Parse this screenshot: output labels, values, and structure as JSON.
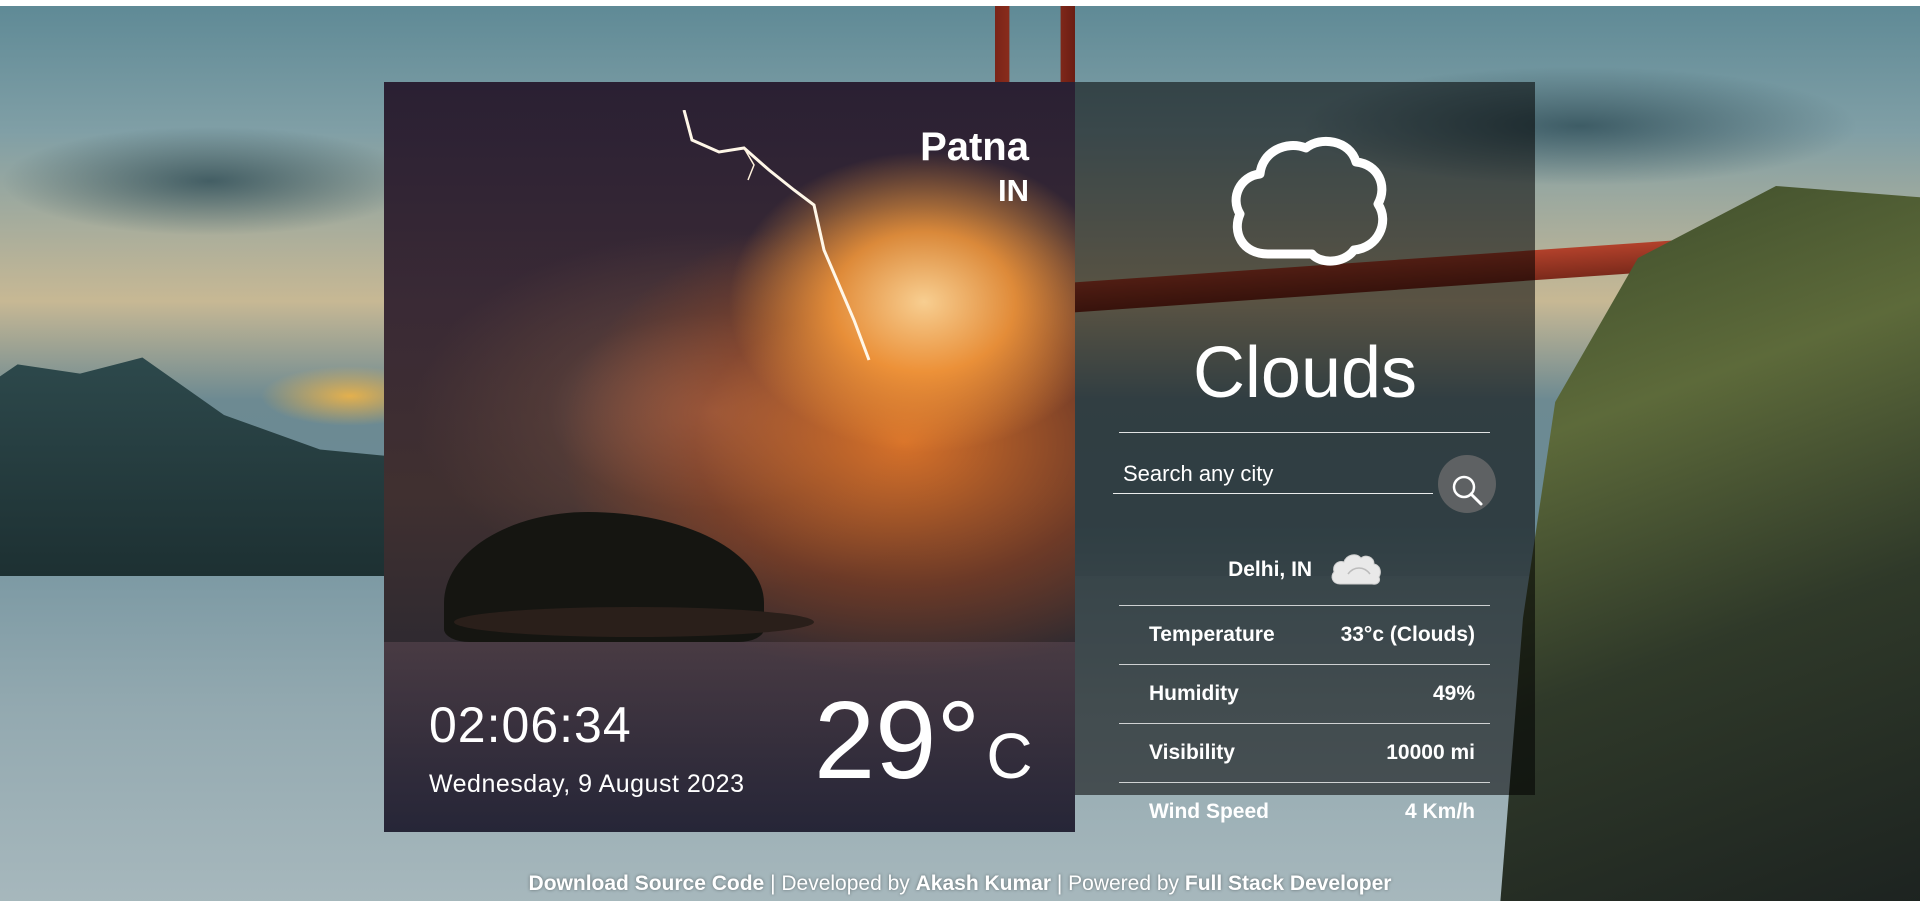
{
  "location": {
    "city": "Patna",
    "country": "IN"
  },
  "clock": {
    "time": "02:06:34",
    "date": "Wednesday, 9 August 2023"
  },
  "current": {
    "temperature": "29°",
    "unit": "C"
  },
  "panel": {
    "condition": "Clouds",
    "search_placeholder": "Search any city",
    "search_icon": "search-icon",
    "weather_icon": "cloud-icon",
    "result": {
      "location": "Delhi, IN",
      "icon": "cloud-icon",
      "rows": [
        {
          "label": "Temperature",
          "value": "33°c (Clouds)"
        },
        {
          "label": "Humidity",
          "value": "49%"
        },
        {
          "label": "Visibility",
          "value": "10000 mi"
        },
        {
          "label": "Wind Speed",
          "value": "4 Km/h"
        }
      ]
    }
  },
  "footer": {
    "download_label": "Download Source Code",
    "sep1": " | Developed by ",
    "author": "Akash Kumar",
    "sep2": " | Powered by ",
    "powered_by": "Full Stack Developer"
  }
}
